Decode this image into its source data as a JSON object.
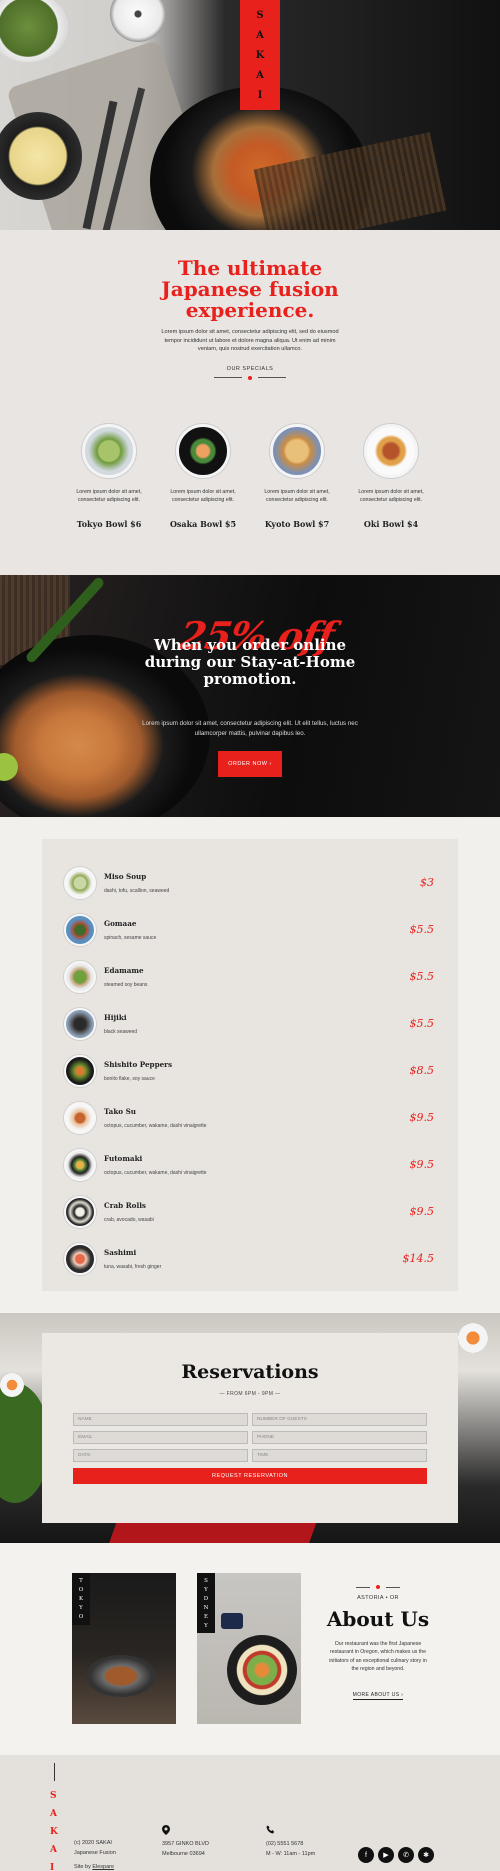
{
  "brand": {
    "logo_letters": [
      "S",
      "A",
      "K",
      "A",
      "I"
    ]
  },
  "intro": {
    "heading": "The ultimate Japanese fusion experience.",
    "lead": "Lorem ipsum dolor sit amet, consectetur adipiscing elit, sed do eiusmod tempor incididunt ut labore et dolore magna aliqua. Ut enim ad minim veniam, quis nostrud exercitation ullamco.",
    "specials_label": "OUR SPECIALS"
  },
  "specials": [
    {
      "name": "Tokyo Bowl $6",
      "desc": "Lorem ipsum dolor sit amet, consectetur adipiscing elit."
    },
    {
      "name": "Osaka Bowl $5",
      "desc": "Lorem ipsum dolor sit amet, consectetur adipiscing elit."
    },
    {
      "name": "Kyoto Bowl $7",
      "desc": "Lorem ipsum dolor sit amet, consectetur adipiscing elit."
    },
    {
      "name": "Oki Bowl $4",
      "desc": "Lorem ipsum dolor sit amet, consectetur adipiscing elit."
    }
  ],
  "promo": {
    "percent": "25% off",
    "heading": "When you order online during our Stay-at-Home promotion.",
    "text": "Lorem ipsum dolor sit amet, consectetur adipiscing elit. Ut elit tellus, luctus nec ullamcorper mattis, pulvinar dapibus leo.",
    "button": "ORDER NOW ›"
  },
  "menu": [
    {
      "name": "Miso Soup",
      "desc": "dashi, tofu, scallion, seaweed",
      "price": "$3"
    },
    {
      "name": "Gomaae",
      "desc": "spinach, sesame sauce",
      "price": "$5.5"
    },
    {
      "name": "Edamame",
      "desc": "steamed soy beans",
      "price": "$5.5"
    },
    {
      "name": "Hijiki",
      "desc": "black seaweed",
      "price": "$5.5"
    },
    {
      "name": "Shishito Peppers",
      "desc": "bonito flake, soy sauce",
      "price": "$8.5"
    },
    {
      "name": "Tako Su",
      "desc": "octopus, cucumber, wakame, dashi vinaigrette",
      "price": "$9.5"
    },
    {
      "name": "Futomaki",
      "desc": "octopus, cucumber, wakame, dashi vinaigrette",
      "price": "$9.5"
    },
    {
      "name": "Crab Rolls",
      "desc": "crab, avocado, wasabi",
      "price": "$9.5"
    },
    {
      "name": "Sashimi",
      "desc": "tuna, wasabi, fresh ginger",
      "price": "$14.5"
    }
  ],
  "reservations": {
    "heading": "Reservations",
    "hours": "— FROM 6PM - 9PM —",
    "fields": {
      "name": "NAME",
      "guests": "NUMBER OF GUESTS",
      "email": "EMAIL",
      "phone": "PHONE",
      "date": "DATE",
      "time": "TIME"
    },
    "button": "REQUEST RESERVATION"
  },
  "about": {
    "cities": [
      {
        "letters": [
          "T",
          "O",
          "K",
          "Y",
          "O"
        ]
      },
      {
        "letters": [
          "S",
          "Y",
          "D",
          "N",
          "E",
          "Y"
        ]
      }
    ],
    "location": "ASTORIA • OR",
    "heading": "About Us",
    "text": "Our restaurant was the first Japanese restaurant in Oregon, which makes us the initiators of an exceptional culinary story in the region and beyond.",
    "link": "MORE ABOUT US ›"
  },
  "footer": {
    "logo_letters": [
      "S",
      "A",
      "K",
      "A",
      "I"
    ],
    "copyright": "(c) 2020 SAKAI",
    "tagline": "Japanese Fusion",
    "site_by_prefix": "Site by",
    "site_by_link": "Elespare",
    "address_1": "3957 GINKO BLVD",
    "address_2": "Melbourne 03694",
    "phone": "(02) 5551 5678",
    "hours": "M - W: 11am - 11pm"
  },
  "icons": {
    "location": "map-pin-icon",
    "phone": "phone-icon",
    "socials": [
      "facebook-icon",
      "youtube-icon",
      "whatsapp-icon",
      "yelp-icon"
    ]
  },
  "colors": {
    "accent": "#e8211d",
    "dark": "#111111",
    "light_bg": "#e8e5e2"
  }
}
